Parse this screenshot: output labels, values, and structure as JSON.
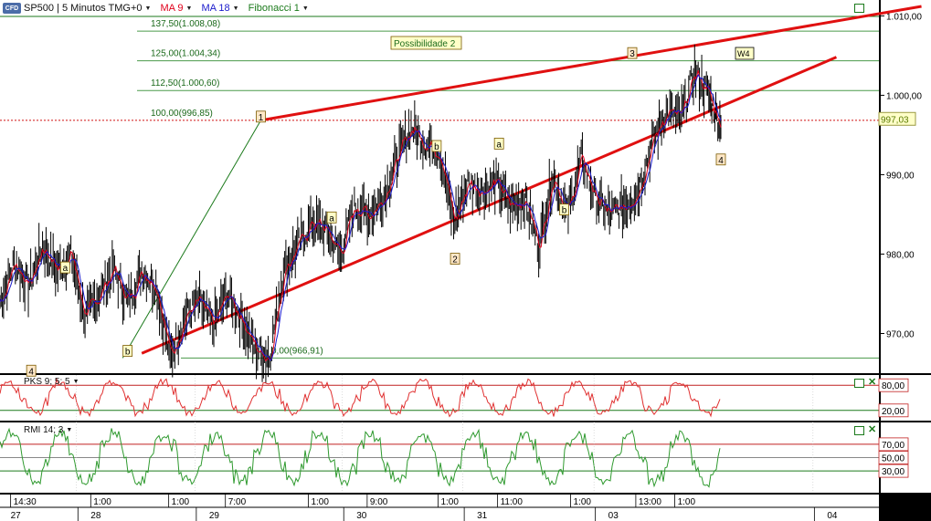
{
  "header": {
    "logo_text": "CFD",
    "symbol": "SP500 | 5 Minutos TMG+0",
    "ma9": "MA 9",
    "ma18": "MA 18",
    "fib": "Fibonacci 1",
    "ma9_color": "#e0001b",
    "ma18_color": "#1a1acc",
    "fib_color": "#1b7a1b"
  },
  "annotation": {
    "possibilidade": "Possibilidade 2",
    "w4": "W4"
  },
  "fib_levels": [
    {
      "label": "137,50(1.008,08)",
      "value": 1008.08
    },
    {
      "label": "125,00(1.004,34)",
      "value": 1004.34
    },
    {
      "label": "112,50(1.000,60)",
      "value": 1000.6
    },
    {
      "label": "100,00(996,85)",
      "value": 996.85
    },
    {
      "label": "0,00(966,91)",
      "value": 966.91
    }
  ],
  "wave_labels": [
    {
      "text": "4",
      "x": 4.4,
      "y": 965.2
    },
    {
      "text": "a",
      "x": 9.2,
      "y": 978.2
    },
    {
      "text": "b",
      "x": 18.0,
      "y": 967.7
    },
    {
      "text": "1",
      "x": 36.8,
      "y": 997.2
    },
    {
      "text": "a",
      "x": 46.8,
      "y": 984.5
    },
    {
      "text": "b",
      "x": 61.6,
      "y": 993.5
    },
    {
      "text": "2",
      "x": 64.2,
      "y": 979.3
    },
    {
      "text": "a",
      "x": 70.4,
      "y": 993.8
    },
    {
      "text": "b",
      "x": 79.6,
      "y": 985.5
    },
    {
      "text": "3",
      "x": 89.2,
      "y": 1005.2
    },
    {
      "text": "4",
      "x": 101.7,
      "y": 991.8
    }
  ],
  "chart_data": {
    "type": "line",
    "title": "SP500 | 5 Minutos TMG+0",
    "ylim": [
      965,
      1012
    ],
    "xlim": [
      0,
      124
    ],
    "yticks": [
      "1.010,00",
      "1.000,00",
      "990,00",
      "980,00",
      "970,00"
    ],
    "ytick_values": [
      1010,
      1000,
      990,
      980,
      970
    ],
    "last_price": "997,03",
    "last_value": 997.03,
    "price_series": {
      "name": "SP500",
      "x": [
        0,
        2,
        4,
        6,
        8,
        10,
        12,
        14,
        16,
        18,
        20,
        22,
        24,
        26,
        28,
        30,
        32,
        34,
        36,
        38,
        40,
        42,
        44,
        46,
        48,
        50,
        52,
        54,
        56,
        58,
        60,
        62,
        64,
        66,
        68,
        70,
        72,
        74,
        76,
        78,
        80,
        82,
        84,
        86,
        88,
        90,
        92,
        94,
        96,
        98,
        100,
        101.7
      ],
      "y": [
        974,
        979,
        976,
        981,
        978,
        980,
        972,
        975,
        978,
        974,
        978,
        976,
        967,
        972,
        974,
        971,
        975,
        972,
        968,
        967,
        978,
        981,
        984,
        983,
        980,
        986,
        985,
        987,
        992,
        996,
        994,
        993,
        984,
        989,
        988,
        989,
        986,
        987,
        981,
        990,
        985,
        992,
        987,
        985,
        986,
        988,
        994,
        998,
        997,
        1003,
        1000,
        996
      ]
    },
    "trendlines": [
      {
        "name": "upper",
        "x": [
          36.8,
          130
        ],
        "y": [
          996.85,
          1011.2
        ],
        "color": "#e01010"
      },
      {
        "name": "lower",
        "x": [
          20,
          118
        ],
        "y": [
          967.5,
          1004.8
        ],
        "color": "#e01010"
      },
      {
        "name": "fib-leg",
        "x": [
          17.3,
          36.8
        ],
        "y": [
          966.91,
          996.85
        ],
        "color": "#1b7a1b"
      }
    ],
    "x_time_labels": [
      {
        "label": "14:30",
        "x": 1.5
      },
      {
        "label": "1:00",
        "x": 12.8
      },
      {
        "label": "1:00",
        "x": 23.8
      },
      {
        "label": "7:00",
        "x": 31.8
      },
      {
        "label": "1:00",
        "x": 43.5
      },
      {
        "label": "9:00",
        "x": 51.8
      },
      {
        "label": "1:00",
        "x": 61.8
      },
      {
        "label": "11:00",
        "x": 70.2
      },
      {
        "label": "1:00",
        "x": 80.5
      },
      {
        "label": "13:00",
        "x": 89.7
      },
      {
        "label": "1:00",
        "x": 95.2
      }
    ],
    "x_date_labels": [
      {
        "label": "27",
        "x": 1.5
      },
      {
        "label": "28",
        "x": 12.8
      },
      {
        "label": "29",
        "x": 29.5
      },
      {
        "label": "30",
        "x": 50.3
      },
      {
        "label": "31",
        "x": 67.3
      },
      {
        "label": "03",
        "x": 85.8
      },
      {
        "label": "04",
        "x": 116.7
      }
    ]
  },
  "pks": {
    "label": "PKS 9; 5; 5",
    "levels": [
      "80,00",
      "20,00"
    ],
    "level_values": [
      80,
      20
    ],
    "ylim": [
      0,
      100
    ],
    "color": "#e03030"
  },
  "rmi": {
    "label": "RMI 14; 3",
    "levels": [
      "70,00",
      "50,00",
      "30,00"
    ],
    "level_values": [
      70,
      50,
      30
    ],
    "ylim": [
      0,
      100
    ],
    "color": "#2f9a2f"
  }
}
